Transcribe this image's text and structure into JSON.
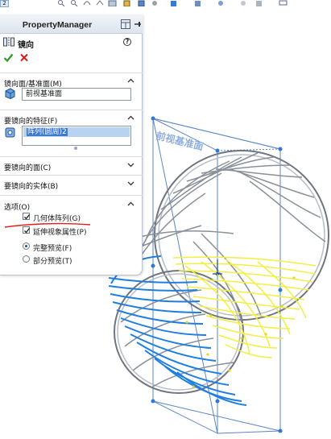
{
  "toolbar": {
    "tab_label": "2"
  },
  "property_manager": {
    "header_title": "PropertyManager",
    "feature_title": "镜向",
    "help_label": "?",
    "groups": {
      "mirror_plane": {
        "title": "镜向面/基准面(M)",
        "value": "前视基准面"
      },
      "features_to_mirror": {
        "title": "要镜向的特征(F)",
        "items": [
          "阵列(圆周)2"
        ]
      },
      "faces_to_mirror": {
        "title": "要镜向的面(C)"
      },
      "bodies_to_mirror": {
        "title": "要镜向的实体(B)"
      },
      "options": {
        "title": "选项(O)",
        "geometry_pattern": {
          "label": "几何体阵列(G)",
          "checked": true
        },
        "propagate_visual": {
          "label": "延伸视象属性(P)",
          "checked": true
        },
        "full_preview": {
          "label": "完整预览(F)",
          "selected": true
        },
        "partial_preview": {
          "label": "部分预览(T)",
          "selected": false
        }
      }
    }
  },
  "graphics": {
    "plane_label": "前视基准面"
  },
  "colors": {
    "accent": "#1a62c4",
    "selection_blue": "#1f7fe0",
    "preview_yellow": "#f2ee44",
    "ok_green": "#2a9a2a",
    "cancel_red": "#d02020"
  }
}
